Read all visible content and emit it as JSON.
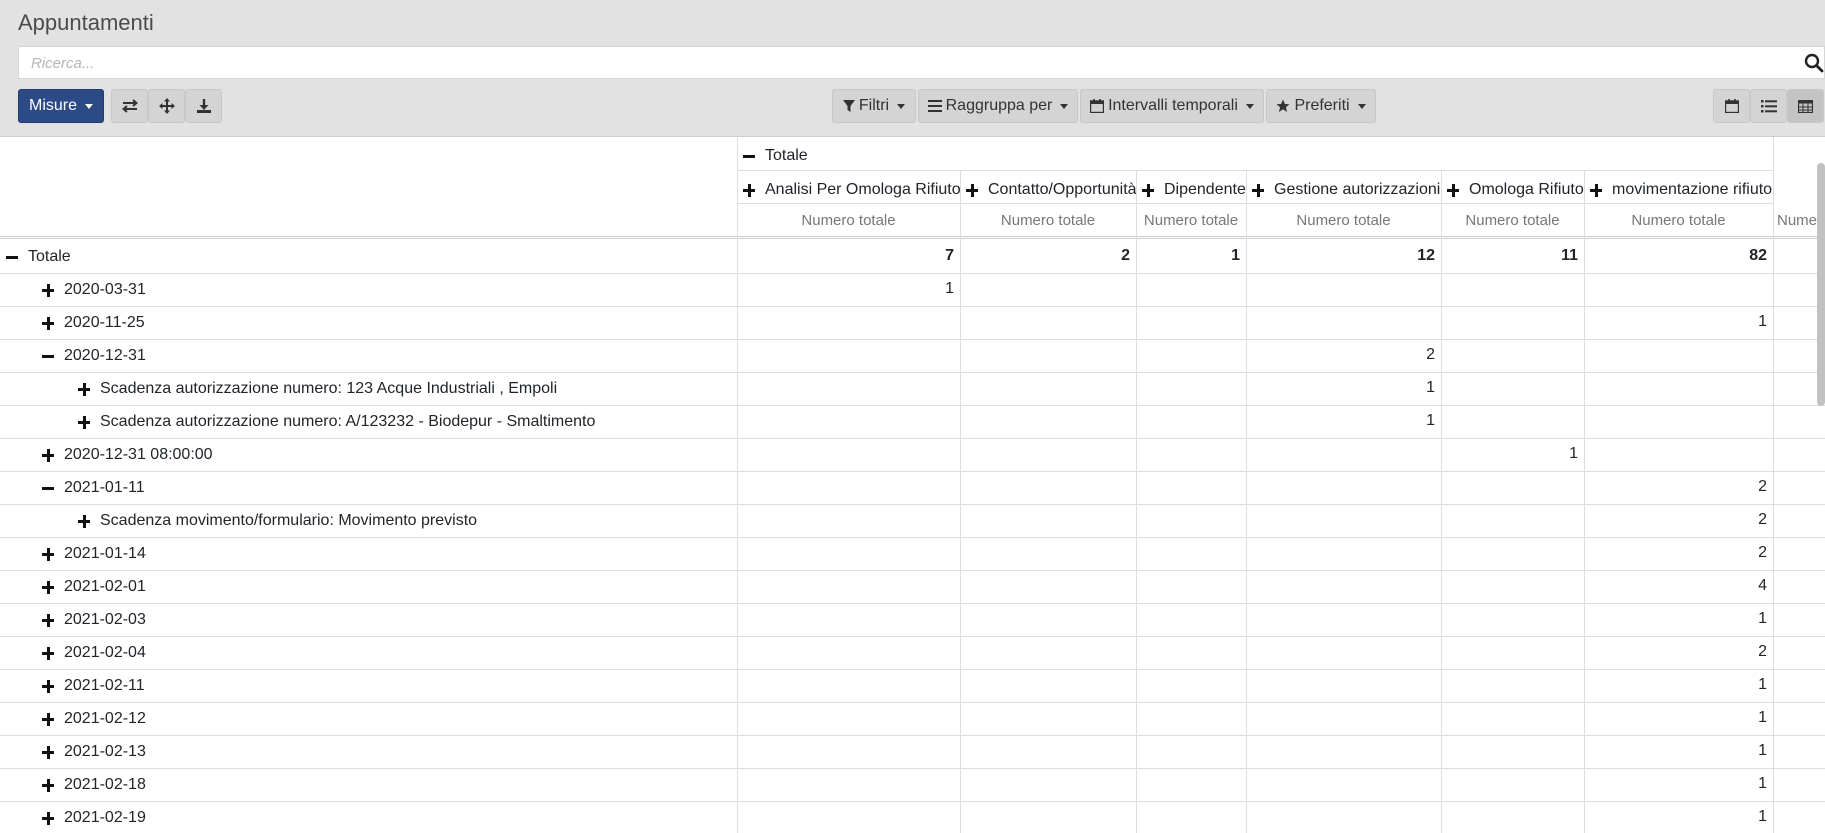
{
  "app": {
    "title": "Appuntamenti",
    "search_placeholder": "Ricerca..."
  },
  "toolbar": {
    "measures_label": "Misure",
    "filters_label": "Filtri",
    "groupby_label": "Raggruppa per",
    "timeranges_label": "Intervalli temporali",
    "favorites_label": "Preferiti",
    "accent_color": "#2c4a86"
  },
  "pivot": {
    "col_total_label": "Totale",
    "columns": [
      {
        "label": "Analisi Per Omologa Rifiuto",
        "measure": "Numero totale",
        "total": "7"
      },
      {
        "label": "Contatto/Opportunità",
        "measure": "Numero totale",
        "total": "2"
      },
      {
        "label": "Dipendente",
        "measure": "Numero totale",
        "total": "1"
      },
      {
        "label": "Gestione autorizzazioni",
        "measure": "Numero totale",
        "total": "12"
      },
      {
        "label": "Omologa Rifiuto",
        "measure": "Numero totale",
        "total": "11"
      },
      {
        "label": "movimentazione rifiuto",
        "measure": "Numero totale",
        "total": "82"
      }
    ],
    "extra_measure_label": "Nume",
    "row_total_label": "Totale",
    "rows": [
      {
        "label": "2020-03-31",
        "expanded": false,
        "level": 1,
        "values": [
          "1",
          "",
          "",
          "",
          "",
          ""
        ]
      },
      {
        "label": "2020-11-25",
        "expanded": false,
        "level": 1,
        "values": [
          "",
          "",
          "",
          "",
          "",
          "1"
        ]
      },
      {
        "label": "2020-12-31",
        "expanded": true,
        "level": 1,
        "values": [
          "",
          "",
          "",
          "2",
          "",
          ""
        ]
      },
      {
        "label": "Scadenza autorizzazione numero: 123 Acque Industriali , Empoli",
        "expanded": false,
        "level": 2,
        "values": [
          "",
          "",
          "",
          "1",
          "",
          ""
        ]
      },
      {
        "label": "Scadenza autorizzazione numero: A/123232 - Biodepur - Smaltimento",
        "expanded": false,
        "level": 2,
        "values": [
          "",
          "",
          "",
          "1",
          "",
          ""
        ]
      },
      {
        "label": "2020-12-31 08:00:00",
        "expanded": false,
        "level": 1,
        "values": [
          "",
          "",
          "",
          "",
          "1",
          ""
        ]
      },
      {
        "label": "2021-01-11",
        "expanded": true,
        "level": 1,
        "values": [
          "",
          "",
          "",
          "",
          "",
          "2"
        ]
      },
      {
        "label": "Scadenza movimento/formulario: Movimento previsto",
        "expanded": false,
        "level": 2,
        "values": [
          "",
          "",
          "",
          "",
          "",
          "2"
        ]
      },
      {
        "label": "2021-01-14",
        "expanded": false,
        "level": 1,
        "values": [
          "",
          "",
          "",
          "",
          "",
          "2"
        ]
      },
      {
        "label": "2021-02-01",
        "expanded": false,
        "level": 1,
        "values": [
          "",
          "",
          "",
          "",
          "",
          "4"
        ]
      },
      {
        "label": "2021-02-03",
        "expanded": false,
        "level": 1,
        "values": [
          "",
          "",
          "",
          "",
          "",
          "1"
        ]
      },
      {
        "label": "2021-02-04",
        "expanded": false,
        "level": 1,
        "values": [
          "",
          "",
          "",
          "",
          "",
          "2"
        ]
      },
      {
        "label": "2021-02-11",
        "expanded": false,
        "level": 1,
        "values": [
          "",
          "",
          "",
          "",
          "",
          "1"
        ]
      },
      {
        "label": "2021-02-12",
        "expanded": false,
        "level": 1,
        "values": [
          "",
          "",
          "",
          "",
          "",
          "1"
        ]
      },
      {
        "label": "2021-02-13",
        "expanded": false,
        "level": 1,
        "values": [
          "",
          "",
          "",
          "",
          "",
          "1"
        ]
      },
      {
        "label": "2021-02-18",
        "expanded": false,
        "level": 1,
        "values": [
          "",
          "",
          "",
          "",
          "",
          "1"
        ]
      },
      {
        "label": "2021-02-19",
        "expanded": false,
        "level": 1,
        "values": [
          "",
          "",
          "",
          "",
          "",
          "1"
        ]
      }
    ]
  }
}
